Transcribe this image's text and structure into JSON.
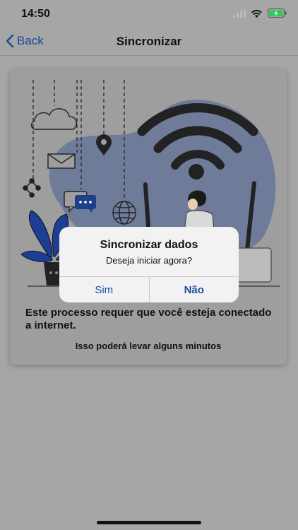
{
  "status_bar": {
    "time": "14:50",
    "icons": [
      "signal-icon",
      "wifi-icon",
      "battery-charging-icon"
    ],
    "battery_color": "#34c759"
  },
  "nav": {
    "back_label": "Back",
    "title": "Sincronizar",
    "accent_color": "#1a4e9a"
  },
  "card": {
    "illustration_icons": [
      "cloud-icon",
      "location-pin-icon",
      "mail-icon",
      "share-icon",
      "chat-bubble-icon",
      "globe-icon",
      "wifi-symbol",
      "router-icon",
      "person-figure",
      "potted-plant"
    ],
    "process_text": "Este processo requer que você esteja conectado a internet.",
    "minutes_text": "Isso poderá levar alguns minutos"
  },
  "alert": {
    "title": "Sincronizar dados",
    "message": "Deseja iniciar agora?",
    "button_yes": "Sim",
    "button_no": "Não"
  }
}
